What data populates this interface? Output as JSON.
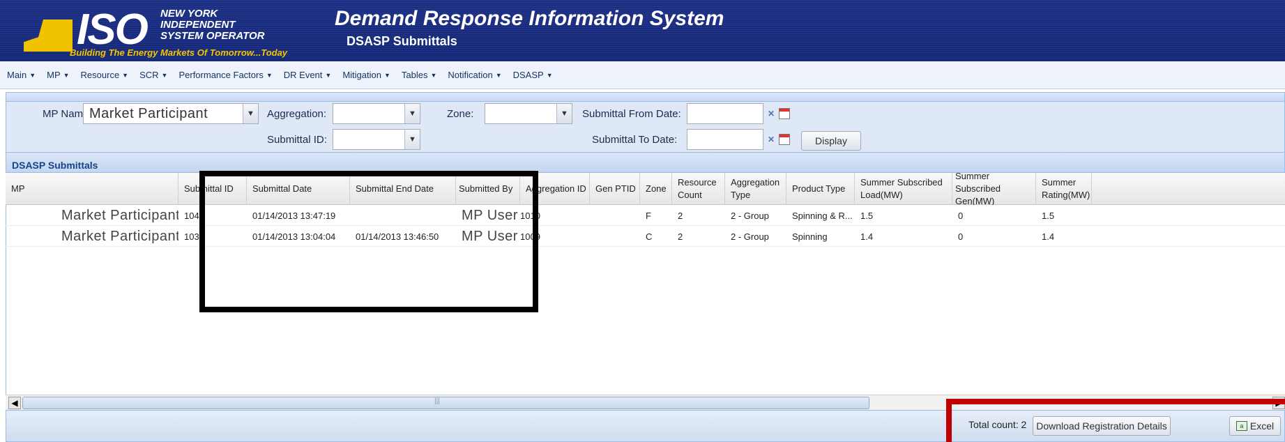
{
  "header": {
    "logo_iso": "ISO",
    "logo_lines": [
      "NEW YORK",
      "INDEPENDENT",
      "SYSTEM OPERATOR"
    ],
    "tagline": "Building The Energy Markets Of Tomorrow...Today",
    "title": "Demand Response Information System",
    "subtitle": "DSASP Submittals"
  },
  "menu": [
    {
      "label": "Main"
    },
    {
      "label": "MP"
    },
    {
      "label": "Resource"
    },
    {
      "label": "SCR"
    },
    {
      "label": "Performance Factors"
    },
    {
      "label": "DR Event"
    },
    {
      "label": "Mitigation"
    },
    {
      "label": "Tables"
    },
    {
      "label": "Notification"
    },
    {
      "label": "DSASP"
    }
  ],
  "filters": {
    "mp_name_label": "MP Name:",
    "mp_name_value": "Market Participant",
    "aggregation_label": "Aggregation:",
    "aggregation_value": "",
    "zone_label": "Zone:",
    "zone_value": "",
    "submittal_id_label": "Submittal ID:",
    "submittal_id_value": "",
    "from_date_label": "Submittal From Date:",
    "to_date_label": "Submittal To Date:",
    "display_button": "Display"
  },
  "grid": {
    "title": "DSASP Submittals",
    "columns": [
      "MP",
      "Submittal ID",
      "Submittal Date",
      "Submittal End Date",
      "Submitted By",
      "Aggregation ID",
      "Gen PTID",
      "Zone",
      "Resource Count",
      "Aggregation Type",
      "Product Type",
      "Summer Subscribed Load(MW)",
      "Summer Subscribed Gen(MW)",
      "Summer Rating(MW)"
    ],
    "rows": [
      [
        "Market Participant",
        "104",
        "01/14/2013 13:47:19",
        "",
        "MP User",
        "1010",
        "",
        "F",
        "2",
        "2 - Group",
        "Spinning & R...",
        "1.5",
        "0",
        "1.5"
      ],
      [
        "Market Participant",
        "103",
        "01/14/2013 13:04:04",
        "01/14/2013 13:46:50",
        "MP User",
        "1009",
        "",
        "C",
        "2",
        "2 - Group",
        "Spinning",
        "1.4",
        "0",
        "1.4"
      ]
    ]
  },
  "footer": {
    "total_count": "Total count: 2",
    "download_button": "Download Registration Details",
    "excel_button": "Excel"
  },
  "colors": {
    "header_bg": "#142777",
    "tagline": "#f3c600",
    "annotation_black": "#000000",
    "annotation_red": "#c00000"
  }
}
